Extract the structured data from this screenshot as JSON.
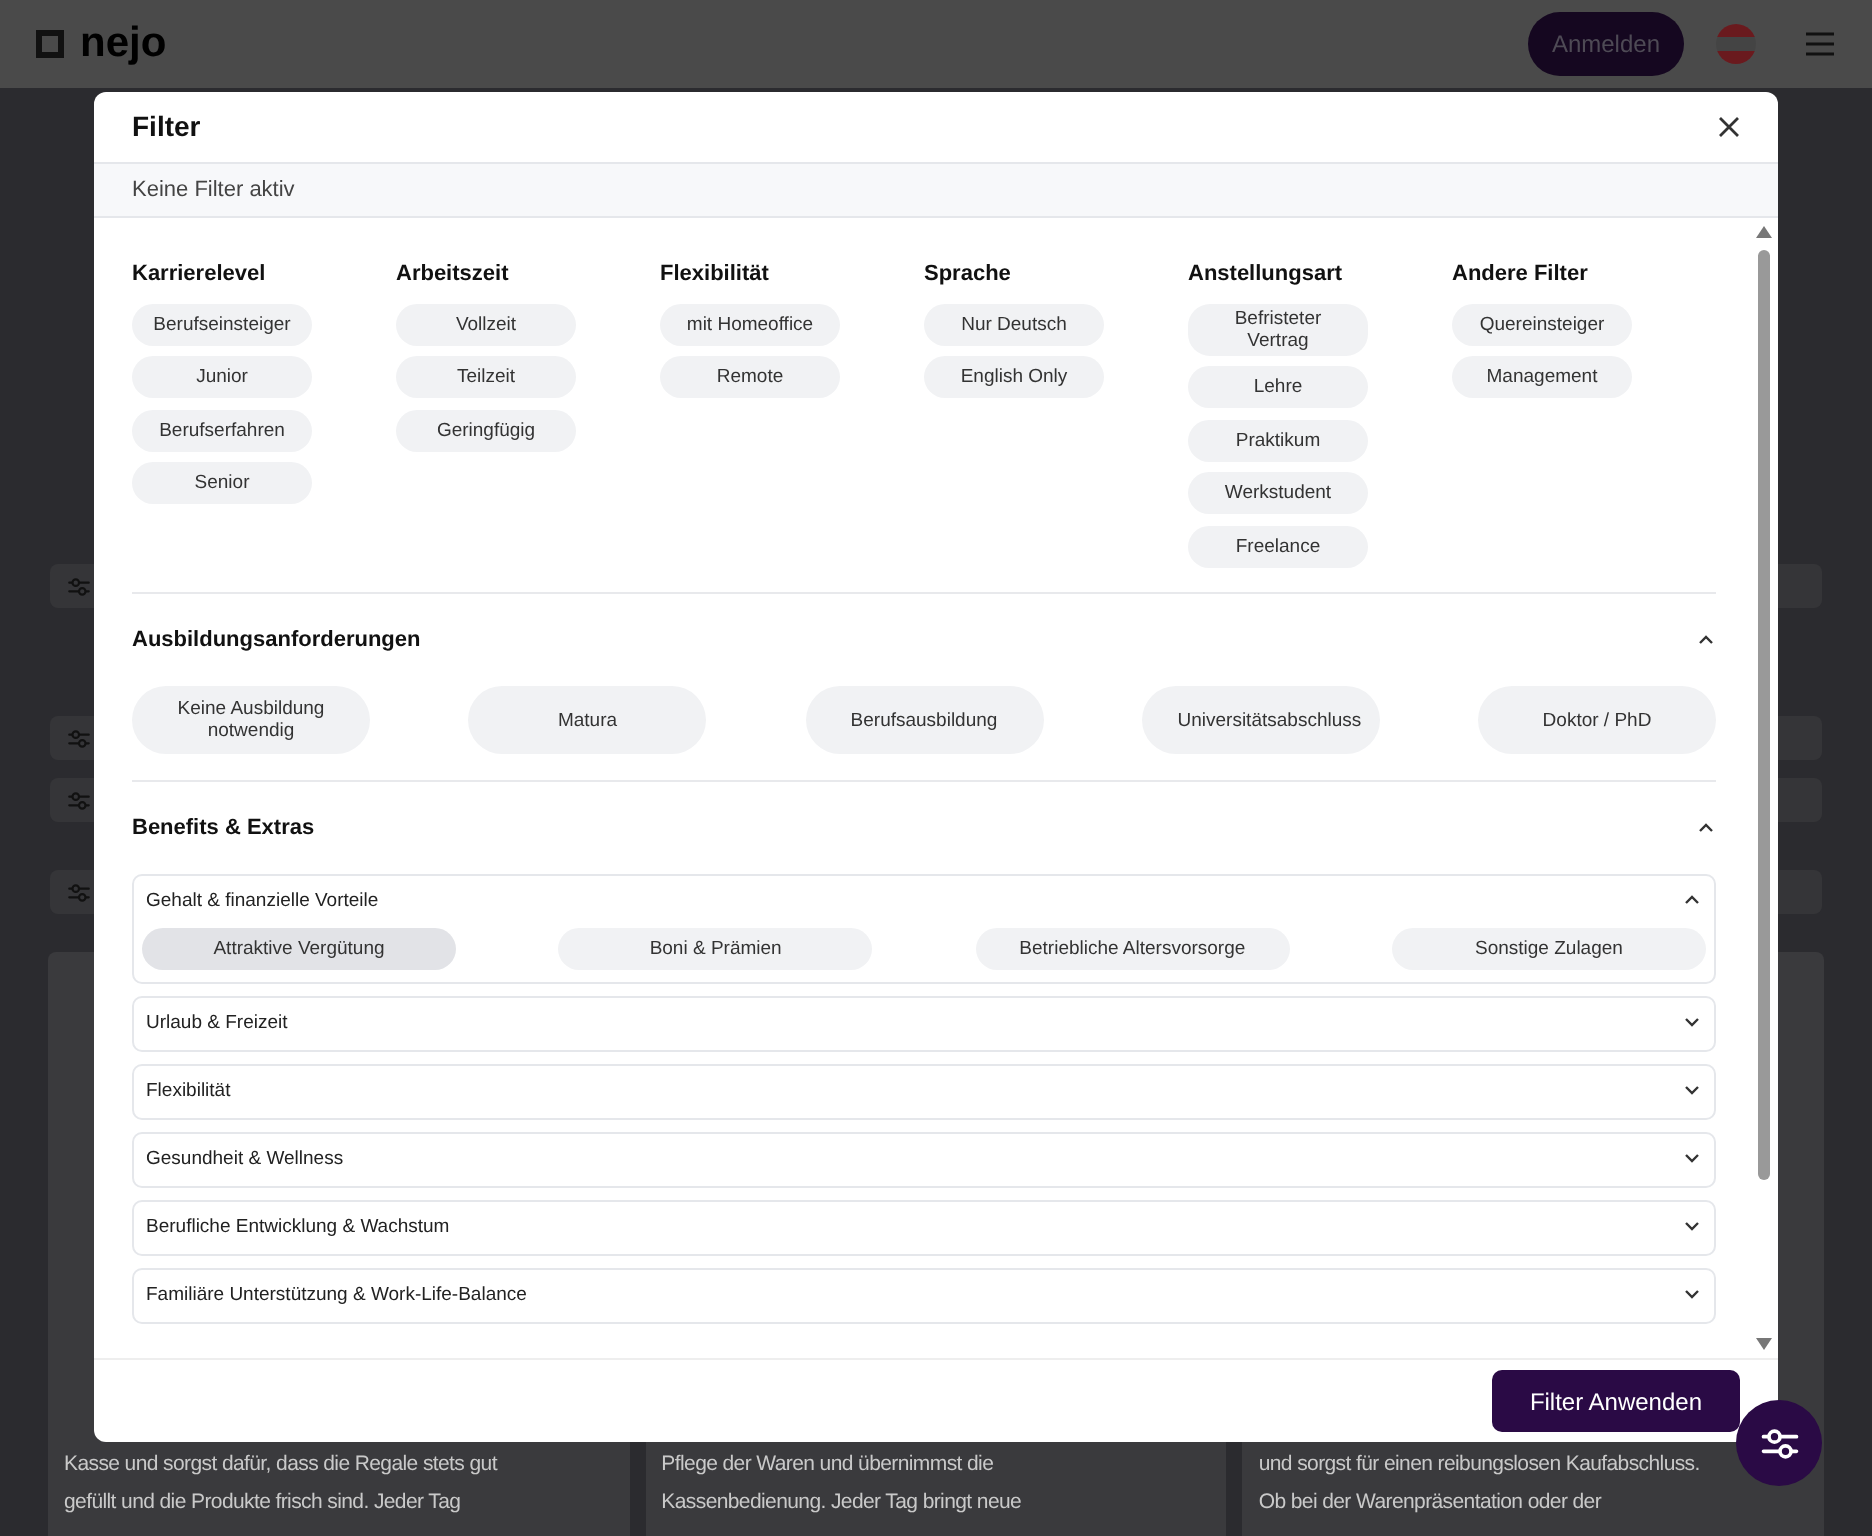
{
  "header": {
    "logo": "nejo",
    "login_button": "Anmelden"
  },
  "background_cards": [
    {
      "lines": [
        "Kasse und sorgst dafür, dass die Regale stets gut",
        "gefüllt und die Produkte frisch sind. Jeder Tag"
      ]
    },
    {
      "lines": [
        "Pflege der Waren und übernimmst die",
        "Kassenbedienung. Jeder Tag bringt neue"
      ]
    },
    {
      "lines": [
        "und sorgst für einen reibungslosen Kaufabschluss.",
        "Ob bei der Warenpräsentation oder der"
      ]
    }
  ],
  "modal": {
    "title": "Filter",
    "active_filters": "Keine Filter aktiv",
    "filter_groups": [
      {
        "title": "Karrierelevel",
        "options": [
          {
            "label": "Berufseinsteiger",
            "selected": false
          },
          {
            "label": "Junior",
            "selected": false
          },
          {
            "label": "Berufserfahren",
            "selected": false
          },
          {
            "label": "Senior",
            "selected": false
          }
        ]
      },
      {
        "title": "Arbeitszeit",
        "options": [
          {
            "label": "Vollzeit",
            "selected": false
          },
          {
            "label": "Teilzeit",
            "selected": false
          },
          {
            "label": "Geringfügig",
            "selected": false
          }
        ]
      },
      {
        "title": "Flexibilität",
        "options": [
          {
            "label": "mit Homeoffice",
            "selected": false
          },
          {
            "label": "Remote",
            "selected": false
          }
        ]
      },
      {
        "title": "Sprache",
        "options": [
          {
            "label": "Nur Deutsch",
            "selected": false
          },
          {
            "label": "English Only",
            "selected": false
          }
        ]
      },
      {
        "title": "Anstellungsart",
        "options": [
          {
            "label": "Befristeter Vertrag",
            "selected": false
          },
          {
            "label": "Lehre",
            "selected": false
          },
          {
            "label": "Praktikum",
            "selected": false
          },
          {
            "label": "Werkstudent",
            "selected": false
          },
          {
            "label": "Freelance",
            "selected": false
          }
        ]
      },
      {
        "title": "Andere Filter",
        "options": [
          {
            "label": "Quereinsteiger",
            "selected": false
          },
          {
            "label": "Management",
            "selected": false
          }
        ]
      }
    ],
    "sections": [
      {
        "title": "Ausbildungsanforderungen",
        "expanded": true,
        "options": [
          {
            "label": "Keine Ausbildung notwendig",
            "selected": false
          },
          {
            "label": "Matura",
            "selected": false
          },
          {
            "label": "Berufsausbildung",
            "selected": false
          },
          {
            "label": "Universitätsabschluss",
            "selected": false
          },
          {
            "label": "Doktor / PhD",
            "selected": false
          }
        ]
      },
      {
        "title": "Benefits & Extras",
        "expanded": true,
        "subsections": [
          {
            "title": "Gehalt & finanzielle Vorteile",
            "expanded": true,
            "options": [
              {
                "label": "Attraktive Vergütung",
                "selected": true
              },
              {
                "label": "Boni & Prämien",
                "selected": false
              },
              {
                "label": "Betriebliche Altersvorsorge",
                "selected": false
              },
              {
                "label": "Sonstige Zulagen",
                "selected": false
              }
            ]
          },
          {
            "title": "Urlaub & Freizeit",
            "expanded": false
          },
          {
            "title": "Flexibilität",
            "expanded": false
          },
          {
            "title": "Gesundheit & Wellness",
            "expanded": false
          },
          {
            "title": "Berufliche Entwicklung & Wachstum",
            "expanded": false
          },
          {
            "title": "Familiäre Unterstützung & Work-Life-Balance",
            "expanded": false
          }
        ]
      }
    ],
    "apply_button": "Filter Anwenden"
  }
}
